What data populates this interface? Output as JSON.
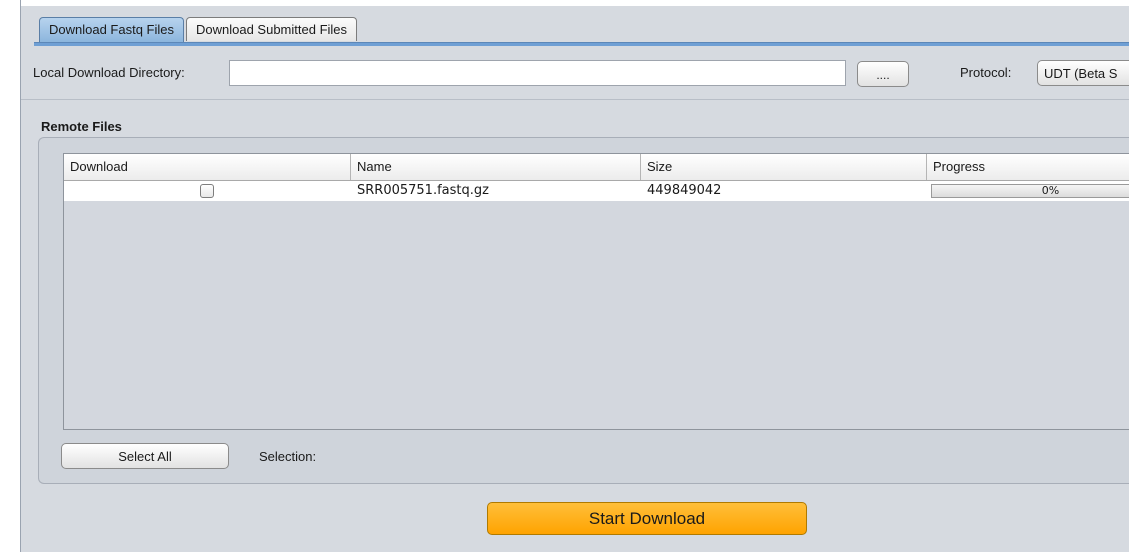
{
  "tabs": [
    {
      "label": "Download Fastq Files",
      "active": true
    },
    {
      "label": "Download Submitted Files",
      "active": false
    }
  ],
  "directory": {
    "label": "Local Download Directory:",
    "value": "",
    "browse_label": "...."
  },
  "protocol": {
    "label": "Protocol:",
    "selected": "UDT (Beta S"
  },
  "remote_files": {
    "title": "Remote Files",
    "columns": [
      "Download",
      "Name",
      "Size",
      "Progress"
    ],
    "rows": [
      {
        "download": false,
        "name": "SRR005751.fastq.gz",
        "size": "449849042",
        "progress": "0%",
        "progress_fraction": 0
      }
    ],
    "select_all_label": "Select All",
    "selection_label": "Selection:"
  },
  "actions": {
    "start_download_label": "Start Download"
  },
  "colors": {
    "accent": "#6f9fd4",
    "start_button": "#ffa300",
    "panel_background": "#d6dae0"
  }
}
